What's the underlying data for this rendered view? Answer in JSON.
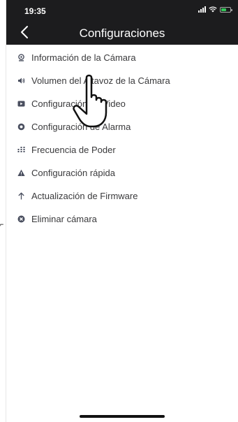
{
  "status_bar": {
    "time": "19:35"
  },
  "header": {
    "title": "Configuraciones"
  },
  "settings_items": [
    {
      "label": "Información de la Cámara",
      "icon": "camera-info-icon"
    },
    {
      "label": "Volumen del Altavoz de la Cámara",
      "icon": "speaker-icon"
    },
    {
      "label": "Configuración de Video",
      "icon": "video-icon"
    },
    {
      "label": "Configuración de Alarma",
      "icon": "alarm-icon"
    },
    {
      "label": "Frecuencia de Poder",
      "icon": "frequency-icon"
    },
    {
      "label": "Configuración rápida",
      "icon": "warning-triangle-icon"
    },
    {
      "label": "Actualización de Firmware",
      "icon": "arrow-up-icon"
    },
    {
      "label": "Eliminar cámara",
      "icon": "remove-icon"
    }
  ],
  "outside_mark": "⌐",
  "colors": {
    "header_bg": "#1c1c1e",
    "icon_color": "#4a4f5f",
    "text_color": "#3a3a3c",
    "battery_green": "#34c759"
  },
  "battery_level": 0.6
}
